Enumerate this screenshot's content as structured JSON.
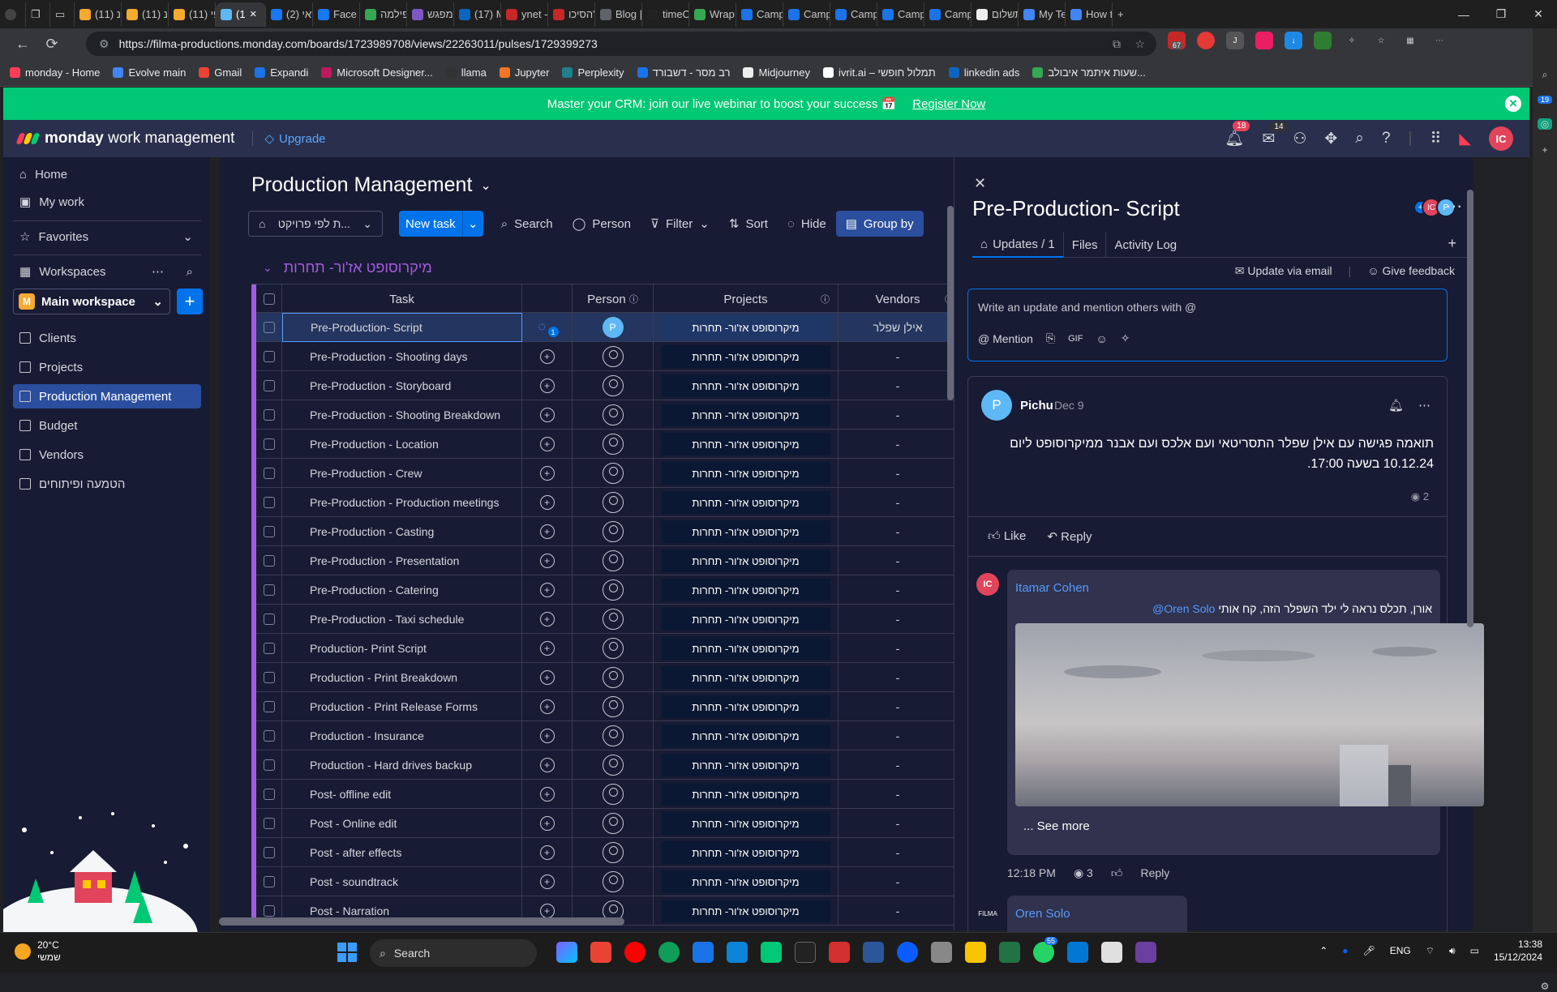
{
  "browser": {
    "tabs": [
      {
        "label": "מנ (11)",
        "color": "#f4a92f"
      },
      {
        "label": "מנ (11)",
        "color": "#f4a92f"
      },
      {
        "label": "פי (11)",
        "color": "#f4a92f"
      },
      {
        "label": "(1",
        "color": "#5fb8f6",
        "active": true
      },
      {
        "label": "סאי (2)",
        "color": "#1877f2"
      },
      {
        "label": "Face (2)",
        "color": "#1877f2"
      },
      {
        "label": "פילמה",
        "color": "#34a853"
      },
      {
        "label": "מפגש",
        "color": "#7e57c2"
      },
      {
        "label": "(17) Mi",
        "color": "#0a66c2"
      },
      {
        "label": "ynet -",
        "color": "#c62828"
      },
      {
        "label": "הסיכו\"",
        "color": "#c62828"
      },
      {
        "label": "Blog | (",
        "color": "#5f6368"
      },
      {
        "label": "timeO",
        "color": "#222"
      },
      {
        "label": "Wrap t",
        "color": "#34a853"
      },
      {
        "label": "Campa",
        "color": "#1a73e8"
      },
      {
        "label": "Campa",
        "color": "#1a73e8"
      },
      {
        "label": "Campa",
        "color": "#1a73e8"
      },
      {
        "label": "Campa",
        "color": "#1a73e8"
      },
      {
        "label": "Campa",
        "color": "#1a73e8"
      },
      {
        "label": "תשלום",
        "color": "#eeeeee"
      },
      {
        "label": "My Tea",
        "color": "#4285f4"
      },
      {
        "label": "How to",
        "color": "#4285f4"
      }
    ],
    "url": "https://filma-productions.monday.com/boards/1723989708/views/22263011/pulses/1729399273",
    "ext_badge": "67",
    "bookmarks": [
      {
        "label": "monday - Home",
        "color": "#ff3d57"
      },
      {
        "label": "Evolve main",
        "color": "#4285f4"
      },
      {
        "label": "Gmail",
        "color": "#ea4335"
      },
      {
        "label": "Expandi",
        "color": "#1a73e8"
      },
      {
        "label": "Microsoft Designer...",
        "color": "#c2185b"
      },
      {
        "label": "llama",
        "color": "#333"
      },
      {
        "label": "Jupyter",
        "color": "#f37626"
      },
      {
        "label": "Perplexity",
        "color": "#20808d"
      },
      {
        "label": "רב מסר - דשבורד",
        "color": "#1a73e8"
      },
      {
        "label": "Midjourney",
        "color": "#eee"
      },
      {
        "label": "ivrit.ai – תמלול חופשי",
        "color": "#fff"
      },
      {
        "label": "linkedin ads",
        "color": "#0a66c2"
      },
      {
        "label": "שעות איתמר איבולב...",
        "color": "#34a853"
      }
    ]
  },
  "banner": {
    "text": "Master your CRM: join our live webinar to boost your success 📅",
    "link": "Register Now"
  },
  "app": {
    "logo_bold": "monday",
    "logo_rest": "work management",
    "upgrade": "Upgrade",
    "notif_count": "18",
    "inbox_count": "14",
    "avatar": "IC"
  },
  "nav": {
    "home": "Home",
    "mywork": "My work",
    "favorites": "Favorites",
    "workspaces": "Workspaces",
    "workspace_name": "Main workspace",
    "workspace_initial": "M",
    "items": [
      "Clients",
      "Projects",
      "Production Management",
      "Budget",
      "Vendors",
      "הטמעה ופיתוחים"
    ]
  },
  "board": {
    "title": "Production Management",
    "view_select": "ת לפי פרויקט...",
    "new_task": "New task",
    "search": "Search",
    "person": "Person",
    "filter": "Filter",
    "sort": "Sort",
    "hide": "Hide",
    "group_by": "Group by",
    "group_title": "מיקרוסופט אז'ור- תחרות",
    "columns": {
      "task": "Task",
      "person": "Person",
      "projects": "Projects",
      "vendors": "Vendors"
    },
    "rows": [
      {
        "task": "Pre-Production- Script",
        "project": "מיקרוסופט אז'ור- תחרות",
        "vendor": "אילן שפלר"
      },
      {
        "task": "Pre-Production - Shooting days",
        "project": "מיקרוסופט אז'ור- תחרות",
        "vendor": "-"
      },
      {
        "task": "Pre-Production - Storyboard",
        "project": "מיקרוסופט אז'ור- תחרות",
        "vendor": "-"
      },
      {
        "task": "Pre-Production - Shooting Breakdown",
        "project": "מיקרוסופט אז'ור- תחרות",
        "vendor": "-"
      },
      {
        "task": "Pre-Production - Location",
        "project": "מיקרוסופט אז'ור- תחרות",
        "vendor": "-"
      },
      {
        "task": "Pre-Production - Crew",
        "project": "מיקרוסופט אז'ור- תחרות",
        "vendor": "-"
      },
      {
        "task": "Pre-Production - Production meetings",
        "project": "מיקרוסופט אז'ור- תחרות",
        "vendor": "-"
      },
      {
        "task": "Pre-Production - Casting",
        "project": "מיקרוסופט אז'ור- תחרות",
        "vendor": "-"
      },
      {
        "task": "Pre-Production - Presentation",
        "project": "מיקרוסופט אז'ור- תחרות",
        "vendor": "-"
      },
      {
        "task": "Pre-Production - Catering",
        "project": "מיקרוסופט אז'ור- תחרות",
        "vendor": "-"
      },
      {
        "task": "Pre-Production - Taxi schedule",
        "project": "מיקרוסופט אז'ור- תחרות",
        "vendor": "-"
      },
      {
        "task": "Production- Print Script",
        "project": "מיקרוסופט אז'ור- תחרות",
        "vendor": "-"
      },
      {
        "task": "Production - Print Breakdown",
        "project": "מיקרוסופט אז'ור- תחרות",
        "vendor": "-"
      },
      {
        "task": "Production - Print Release Forms",
        "project": "מיקרוסופט אז'ור- תחרות",
        "vendor": "-"
      },
      {
        "task": "Production - Insurance",
        "project": "מיקרוסופט אז'ור- תחרות",
        "vendor": "-"
      },
      {
        "task": "Production - Hard drives backup",
        "project": "מיקרוסופט אז'ור- תחרות",
        "vendor": "-"
      },
      {
        "task": "Post- offline edit",
        "project": "מיקרוסופט אז'ור- תחרות",
        "vendor": "-"
      },
      {
        "task": "Post - Online edit",
        "project": "מיקרוסופט אז'ור- תחרות",
        "vendor": "-"
      },
      {
        "task": "Post - after effects",
        "project": "מיקרוסופט אז'ור- תחרות",
        "vendor": "-"
      },
      {
        "task": "Post - soundtrack",
        "project": "מיקרוסופט אז'ור- תחרות",
        "vendor": "-"
      },
      {
        "task": "Post - Narration",
        "project": "מיקרוסופט אז'ור- תחרות",
        "vendor": "-"
      }
    ],
    "selected_person": "P",
    "update_count": "1"
  },
  "pane": {
    "title": "Pre-Production- Script",
    "avatars": [
      "IC",
      "P"
    ],
    "tabs": [
      "Updates / 1",
      "Files",
      "Activity Log"
    ],
    "update_email": "Update via email",
    "feedback": "Give feedback",
    "editor_placeholder": "Write an update and mention others with @",
    "mention": "Mention",
    "gif": "GIF",
    "post": {
      "avatar": "P",
      "author": "Pichu",
      "date": "Dec 9",
      "body": "תואמה פגישה עם אילן שפלר התסריטאי ועם אלכס ועם אבנר ממיקרוסופט ליום 10.12.24 בשעה 17:00.",
      "views": "2",
      "like": "Like",
      "reply": "Reply"
    },
    "reply1": {
      "avatar": "IC",
      "name": "Itamar Cohen",
      "mention": "Oren Solo@",
      "text": "אורן, תכלס נראה לי ילד השפלר הזה, קח אותי",
      "see_more": "... See more",
      "time": "12:18 PM",
      "views": "3",
      "reply": "Reply"
    },
    "reply2": {
      "avatar": "FILMA",
      "name": "Oren Solo"
    }
  },
  "taskbar": {
    "temp": "20°C",
    "weather": "שמשי",
    "search": "Search",
    "lang": "ENG",
    "time": "13:38",
    "date": "15/12/2024",
    "whatsapp_badge": "55"
  }
}
